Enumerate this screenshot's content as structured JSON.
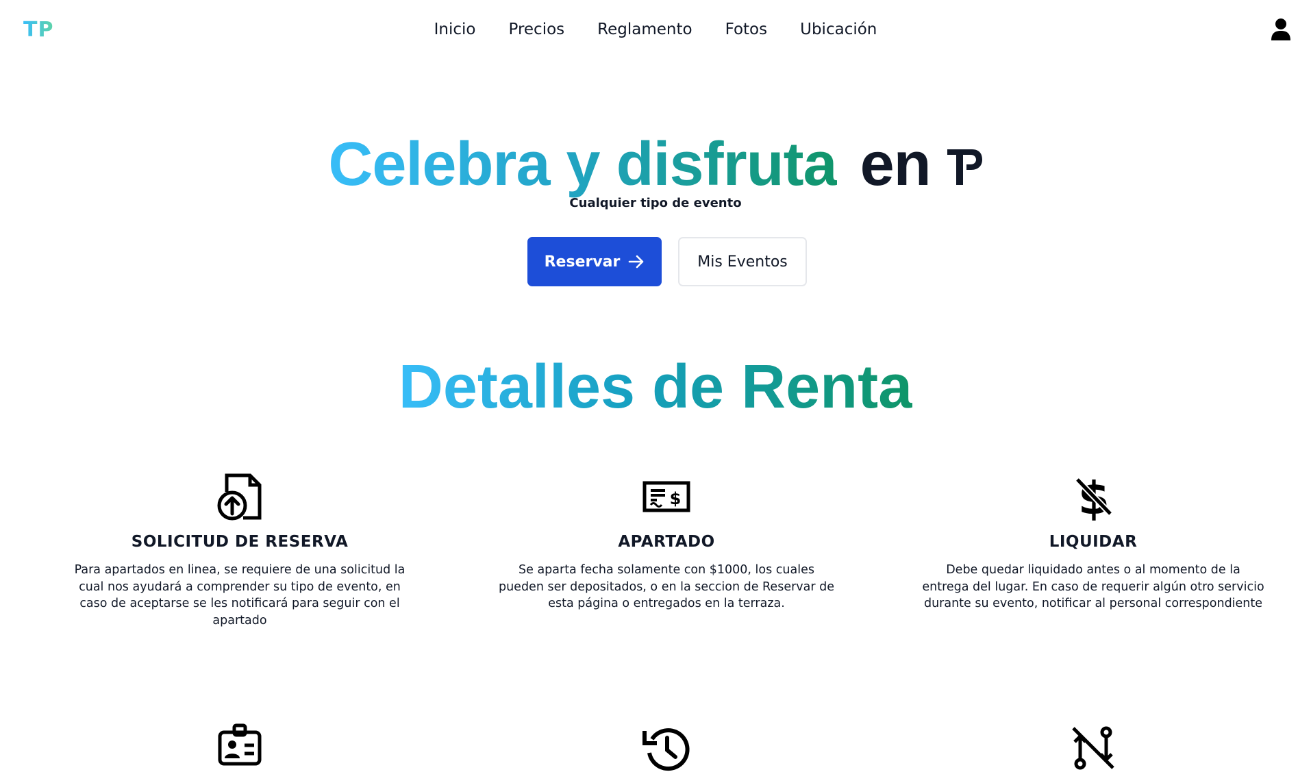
{
  "navbar": {
    "logo": "TP",
    "links": [
      "Inicio",
      "Precios",
      "Reglamento",
      "Fotos",
      "Ubicación"
    ],
    "user_icon": "user-icon"
  },
  "hero": {
    "title_gradient": "Celebra y disfruta",
    "title_dark": "en",
    "subtitle": "Cualquier tipo de evento",
    "primary_button": "Reservar",
    "secondary_button": "Mis Eventos"
  },
  "details": {
    "title": "Detalles de Renta",
    "cards": [
      {
        "icon": "file-upload-icon",
        "title": "SOLICITUD DE RESERVA",
        "text": "Para apartados en linea, se requiere de una solicitud la cual nos ayudará a comprender su tipo de evento, en caso de aceptarse se les notificará para seguir con el apartado"
      },
      {
        "icon": "check-money-icon",
        "title": "APARTADO",
        "text": "Se aparta fecha solamente con $1000, los cuales pueden ser depositados, o en la seccion de Reservar de esta página o entregados en la terraza."
      },
      {
        "icon": "dollar-off-icon",
        "title": "LIQUIDAR",
        "text": "Debe quedar liquidado antes o al momento de la entrega del lugar. En caso de requerir algún otro servicio durante su evento, notificar al personal correspondiente"
      },
      {
        "icon": "id-badge-icon"
      },
      {
        "icon": "history-icon"
      },
      {
        "icon": "transfer-off-icon"
      }
    ]
  },
  "colors": {
    "primary_button": "#1d4ed8",
    "gradient_start": "#38bdf8",
    "gradient_end": "#10956a",
    "text": "#111827"
  }
}
